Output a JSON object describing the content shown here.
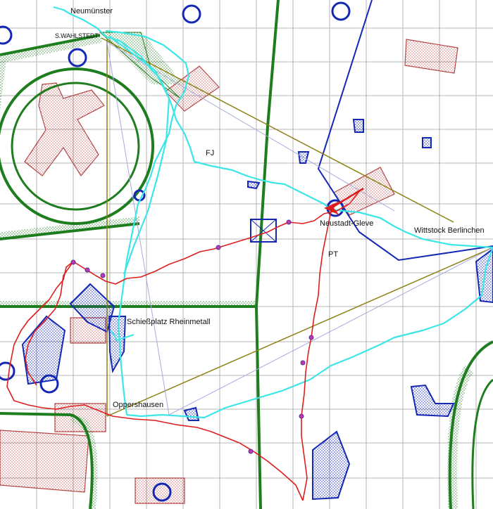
{
  "labels": {
    "neumuenster": "Neumünster",
    "wahlstedt": "S.WAHLSTEDT",
    "fj": "FJ",
    "neustadt_gleve": "Neustadt-Gleve",
    "wittstock_berlinchen": "Wittstock Berlinchen",
    "pt": "PT",
    "schiessplatz": "Schießplatz Rheinmetall",
    "oppershausen": "Oppershausen"
  },
  "colors": {
    "grid": "#b4b4b4",
    "restricted_green": "#1e7d1e",
    "restricted_blue": "#1428b4",
    "danger_red": "#b44646",
    "track_red": "#dc1e1e",
    "track_cyan": "#3ce6e6",
    "route_olive": "#8c8214",
    "route_lavender": "#aaaadc"
  }
}
